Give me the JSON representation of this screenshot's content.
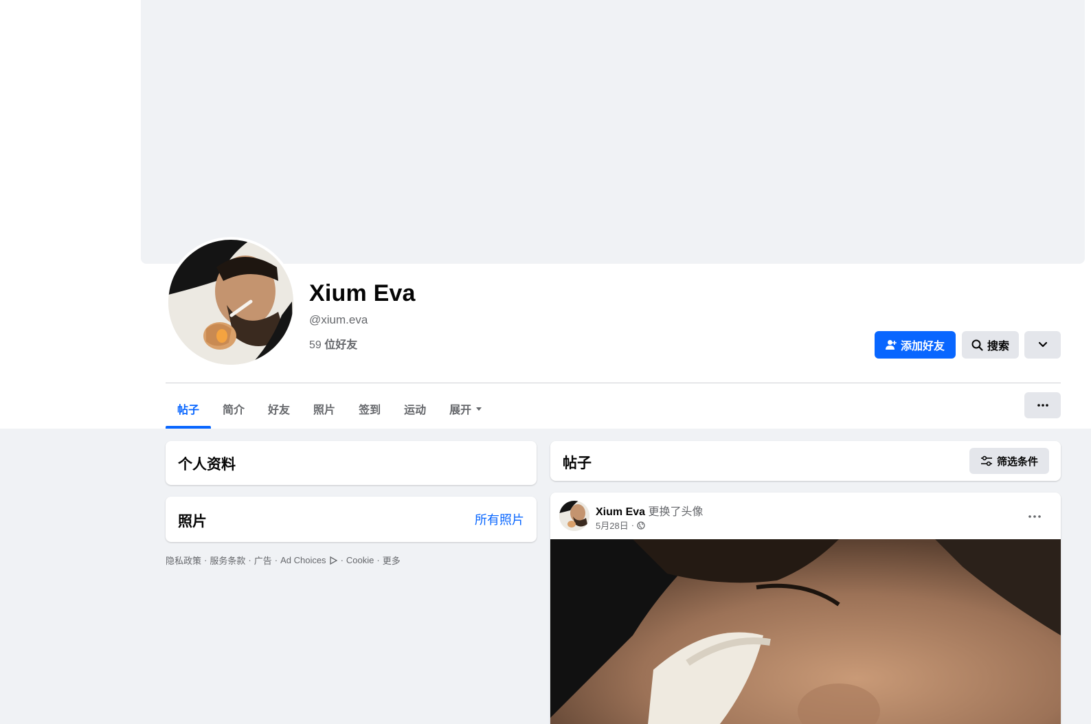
{
  "profile": {
    "name": "Xium Eva",
    "handle": "@xium.eva",
    "friend_count": "59",
    "friend_label": "位好友"
  },
  "actions": {
    "add_friend": "添加好友",
    "search": "搜索"
  },
  "tabs": [
    {
      "label": "帖子",
      "active": true
    },
    {
      "label": "简介"
    },
    {
      "label": "好友"
    },
    {
      "label": "照片"
    },
    {
      "label": "签到"
    },
    {
      "label": "运动"
    },
    {
      "label": "展开"
    }
  ],
  "left": {
    "intro_title": "个人资料",
    "photos_title": "照片",
    "photos_link": "所有照片",
    "footer": [
      "隐私政策",
      "服务条款",
      "广告",
      "Ad Choices",
      "Cookie",
      "更多"
    ]
  },
  "posts": {
    "title": "帖子",
    "filter_label": "筛选条件",
    "items": [
      {
        "author": "Xium Eva",
        "action": "更换了头像",
        "date": "5月28日",
        "separator": "·"
      }
    ]
  },
  "colors": {
    "accent": "#0866ff",
    "page_bg": "#f0f2f5",
    "secondary_text": "#65676b",
    "button_gray": "#e4e6eb"
  }
}
